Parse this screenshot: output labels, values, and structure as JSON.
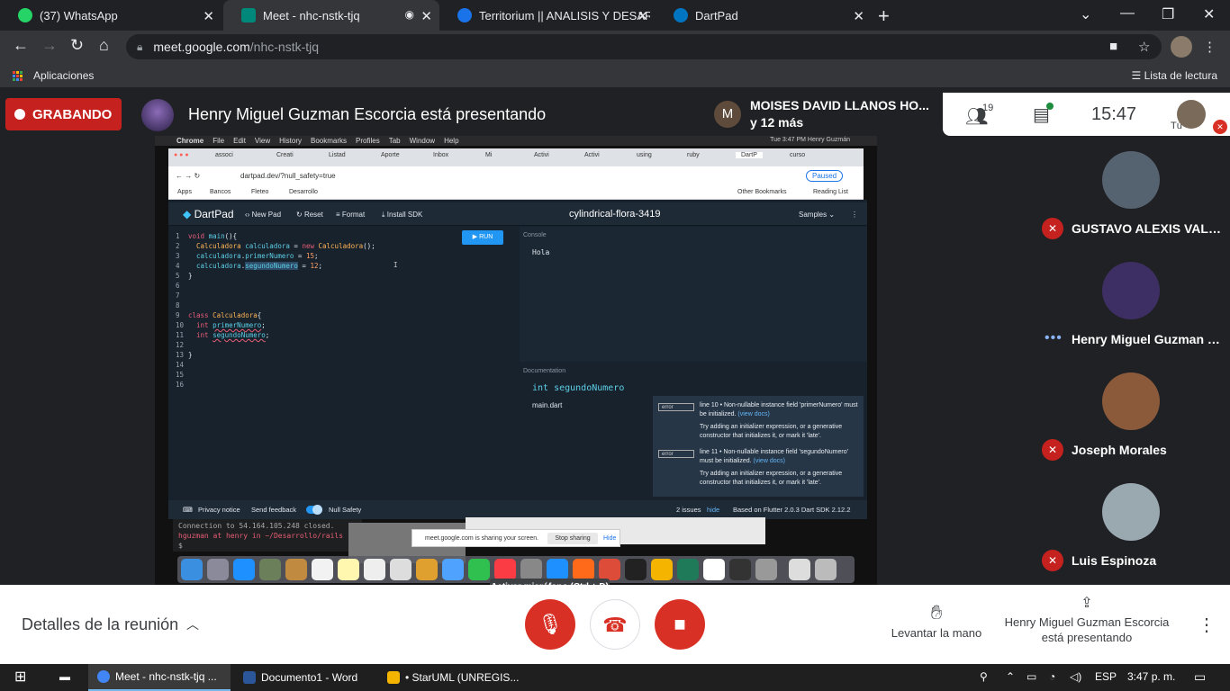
{
  "browser": {
    "tabs": [
      {
        "title": "(37) WhatsApp",
        "favicon_color": "#25d366",
        "active": false
      },
      {
        "title": "Meet - nhc-nstk-tjq",
        "favicon_color": "#00897b",
        "active": true
      },
      {
        "title": "Territorium || ANALISIS Y DESARR",
        "favicon_color": "#1a73e8",
        "active": false
      },
      {
        "title": "DartPad",
        "favicon_color": "#0175c2",
        "active": false
      }
    ],
    "url_host": "meet.google.com",
    "url_path": "/nhc-nstk-tjq",
    "bookmarks": {
      "apps_label": "Aplicaciones",
      "reading_list": "Lista de lectura"
    }
  },
  "meet": {
    "recording_label": "GRABANDO",
    "presenting_title": "Henry Miguel Guzman Escorcia está presentando",
    "featured": {
      "initial": "M",
      "line1": "MOISES DAVID LLANOS HO...",
      "line2": "y 12 más"
    },
    "people_count": "19",
    "clock": "15:47",
    "me_label": "Tú",
    "participants": [
      {
        "name": "GUSTAVO ALEXIS VALDE...",
        "muted": true,
        "avatar_color": "#556270"
      },
      {
        "name": "Henry Miguel Guzman Es...",
        "muted": false,
        "avatar_color": "#3d2f63"
      },
      {
        "name": "Joseph Morales",
        "muted": true,
        "avatar_color": "#8a5a3a"
      },
      {
        "name": "Luis Espinoza",
        "muted": true,
        "avatar_color": "#9aa8b0"
      }
    ],
    "tooltip": "Activar micrófono (Ctrl + D)",
    "bottom": {
      "details": "Detalles de la reunión",
      "raise_hand": "Levantar la mano",
      "presenting_note": "Henry Miguel Guzman Escorcia está presentando"
    }
  },
  "shared_screen": {
    "mac_menu": [
      "Chrome",
      "File",
      "Edit",
      "View",
      "History",
      "Bookmarks",
      "Profiles",
      "Tab",
      "Window",
      "Help"
    ],
    "mac_status": "Tue 3:47 PM   Henry Guzmán",
    "inner_tabs": [
      "associ",
      "Creati",
      "Listad",
      "Aporte",
      "Inbox",
      "Mi",
      "Activi",
      "Activi",
      "using",
      "ruby",
      "DartP",
      "curso"
    ],
    "inner_url": "dartpad.dev/?null_safety=true",
    "inner_paused": "Paused",
    "inner_bookmarks": [
      "Apps",
      "Bancos",
      "Fleteo",
      "Desarrollo"
    ],
    "inner_bm_right": [
      "Other Bookmarks",
      "Reading List"
    ],
    "dartpad": {
      "logo": "DartPad",
      "new_pad": "New Pad",
      "reset": "Reset",
      "format": "Format",
      "install_sdk": "Install SDK",
      "title": "cylindrical-flora-3419",
      "samples": "Samples",
      "run": "RUN",
      "code_lines": [
        "void main(){",
        "  Calculadora calculadora = new Calculadora();",
        "  calculadora.primerNumero = 15;",
        "  calculadora.segundoNumero = 12;",
        "}",
        "",
        "",
        "",
        "class Calculadora{",
        "  int primerNumero;",
        "  int segundoNumero;",
        "",
        "}",
        "",
        "",
        ""
      ],
      "console_label": "Console",
      "console_output": "Hola",
      "doc_label": "Documentation",
      "doc_signature": "int segundoNumero",
      "doc_file": "main.dart",
      "issues": [
        {
          "tag": "error",
          "line1": "line 10 • Non-nullable instance field 'primerNumero' must be initialized.",
          "link": "(view docs)",
          "hint": "Try adding an initializer expression, or a generative constructor that initializes it, or mark it 'late'."
        },
        {
          "tag": "error",
          "line1": "line 11 • Non-nullable instance field 'segundoNumero' must be initialized.",
          "link": "(view docs)",
          "hint": "Try adding an initializer expression, or a generative constructor that initializes it, or mark it 'late'."
        }
      ],
      "footer": {
        "privacy": "Privacy notice",
        "feedback": "Send feedback",
        "null_safety": "Null Safety",
        "issues_count": "2 issues",
        "hide": "hide",
        "based_on": "Based on Flutter 2.0.3 Dart SDK 2.12.2"
      }
    },
    "terminal": [
      "Connection to 54.164.105.248 closed.",
      "hguzman at henry in ~/Desarrollo/rails",
      "$"
    ],
    "share_bar": {
      "text": "meet.google.com is sharing your screen.",
      "stop": "Stop sharing",
      "hide": "Hide"
    }
  },
  "taskbar": {
    "items": [
      {
        "label": "Meet - nhc-nstk-tjq ...",
        "color": "#4285f4",
        "active": true
      },
      {
        "label": "Documento1 - Word",
        "color": "#2b579a",
        "active": false
      },
      {
        "label": "• StarUML (UNREGIS...",
        "color": "#f4b400",
        "active": false
      }
    ],
    "language": "ESP",
    "time": "3:47 p. m."
  }
}
